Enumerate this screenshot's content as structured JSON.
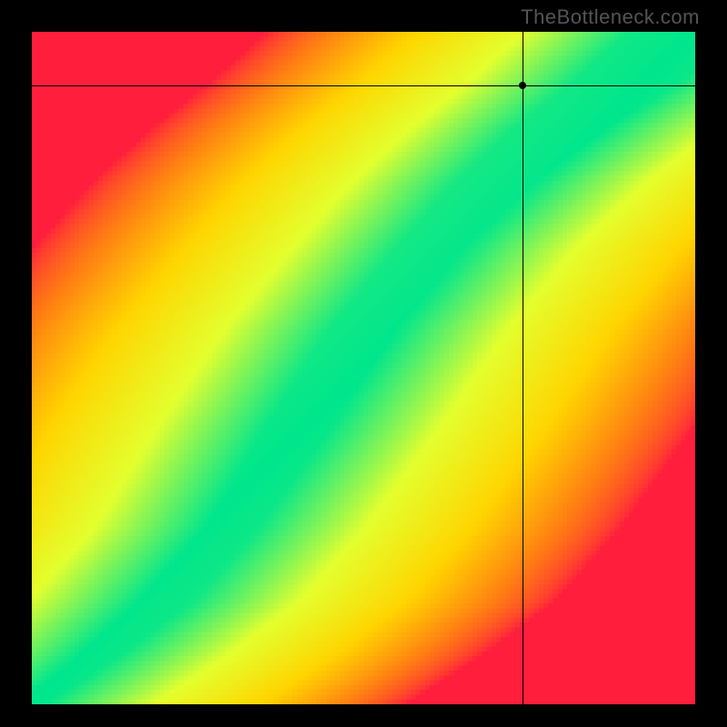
{
  "watermark": "TheBottleneck.com",
  "chart_data": {
    "type": "heatmap",
    "title": "",
    "xlabel": "",
    "ylabel": "",
    "xlim": [
      0,
      1
    ],
    "ylim": [
      0,
      1
    ],
    "grid": false,
    "legend": false,
    "crosshair": {
      "x": 0.74,
      "y": 0.92
    },
    "marker": {
      "x": 0.74,
      "y": 0.92
    },
    "optimal_curve_x": [
      0.0,
      0.1,
      0.2,
      0.3,
      0.4,
      0.5,
      0.6,
      0.7,
      0.8,
      0.9,
      1.0
    ],
    "optimal_curve_y": [
      0.0,
      0.07,
      0.15,
      0.26,
      0.41,
      0.56,
      0.68,
      0.78,
      0.86,
      0.93,
      1.0
    ],
    "band_half_width_x": [
      0.02,
      0.03,
      0.04,
      0.04,
      0.05,
      0.05,
      0.05,
      0.06,
      0.07,
      0.08,
      0.1
    ],
    "colormap_stops": [
      {
        "t": 0.0,
        "hex": "#ff1e3c"
      },
      {
        "t": 0.25,
        "hex": "#ff7a14"
      },
      {
        "t": 0.5,
        "hex": "#ffd500"
      },
      {
        "t": 0.75,
        "hex": "#e3ff2e"
      },
      {
        "t": 1.0,
        "hex": "#00e68c"
      }
    ],
    "resolution": 140
  }
}
